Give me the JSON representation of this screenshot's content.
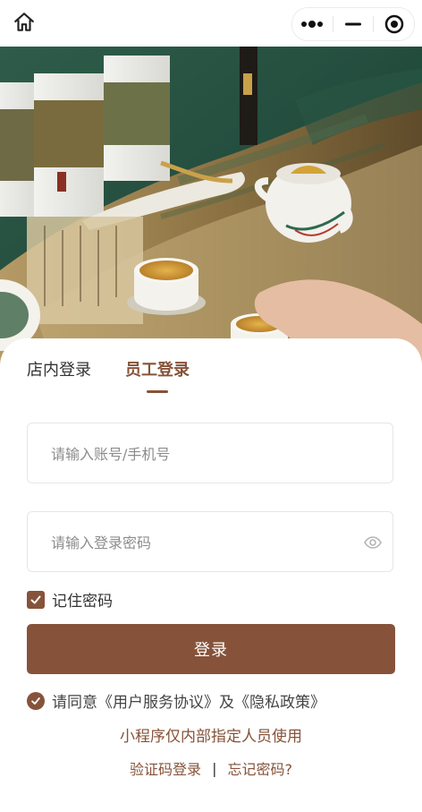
{
  "topbar": {
    "home_icon": "home-icon",
    "more_icon": "more-dots-icon",
    "minimize_icon": "minimize-icon",
    "close_icon": "target-close-icon"
  },
  "hero": {
    "description_icon": "tea-set-photo"
  },
  "tabs": [
    {
      "label": "店内登录",
      "active": false
    },
    {
      "label": "员工登录",
      "active": true
    }
  ],
  "form": {
    "account_placeholder": "请输入账号/手机号",
    "password_placeholder": "请输入登录密码",
    "remember_label": "记住密码",
    "remember_checked": true,
    "login_label": "登录"
  },
  "agreement": {
    "prefix": "请同意",
    "user_agreement": "《用户服务协议》",
    "joiner": "及",
    "privacy_policy": "《隐私政策》",
    "checked": true
  },
  "notice": "小程序仅内部指定人员使用",
  "links": {
    "sms_login": "验证码登录",
    "separator": "|",
    "forgot_password": "忘记密码?"
  },
  "colors": {
    "accent": "#86533a",
    "hero_green": "#1d4a3c"
  }
}
